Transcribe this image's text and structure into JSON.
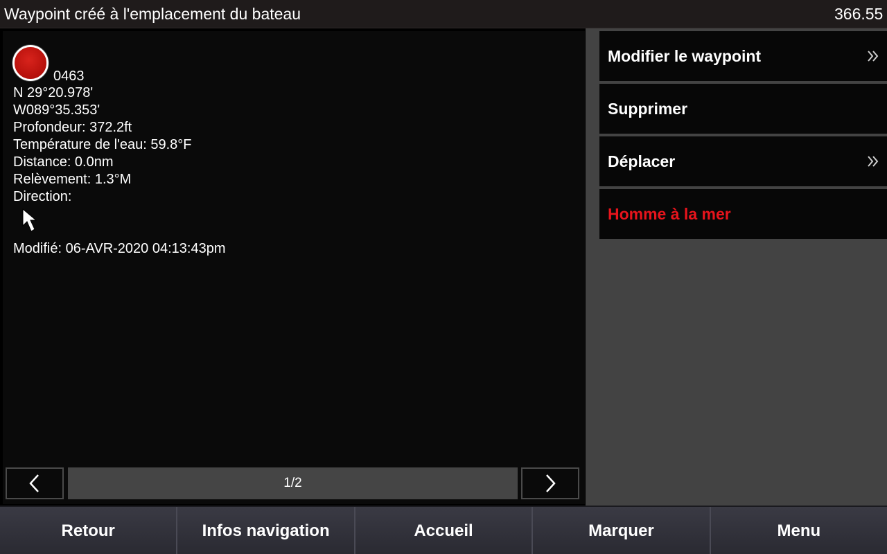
{
  "titlebar": {
    "title": "Waypoint créé à l'emplacement du bateau",
    "value": "366.55"
  },
  "waypoint": {
    "icon": "red-waypoint-circle",
    "icon_color": "#c8140f",
    "name": "0463",
    "latitude": "N  29°20.978'",
    "longitude": "W089°35.353'",
    "depth": "Profondeur: 372.2ft",
    "water_temp": "Température de l'eau: 59.8°F",
    "distance": "Distance: 0.0nm",
    "bearing": "Relèvement: 1.3°M",
    "direction": "Direction:",
    "direction_icon": "arrow-up-pointer-icon",
    "modified": "Modifié: 06-AVR-2020 04:13:43pm"
  },
  "pager": {
    "page": "1/2",
    "prev_icon": "chevron-left-icon",
    "next_icon": "chevron-right-icon"
  },
  "menu": {
    "items": [
      {
        "label": "Modifier le waypoint",
        "has_submenu": true
      },
      {
        "label": "Supprimer",
        "has_submenu": false
      },
      {
        "label": "Déplacer",
        "has_submenu": true
      },
      {
        "label": "Homme à la mer",
        "has_submenu": false,
        "color": "#e8141c"
      }
    ]
  },
  "bottombar": {
    "buttons": [
      "Retour",
      "Infos navigation",
      "Accueil",
      "Marquer",
      "Menu"
    ]
  }
}
